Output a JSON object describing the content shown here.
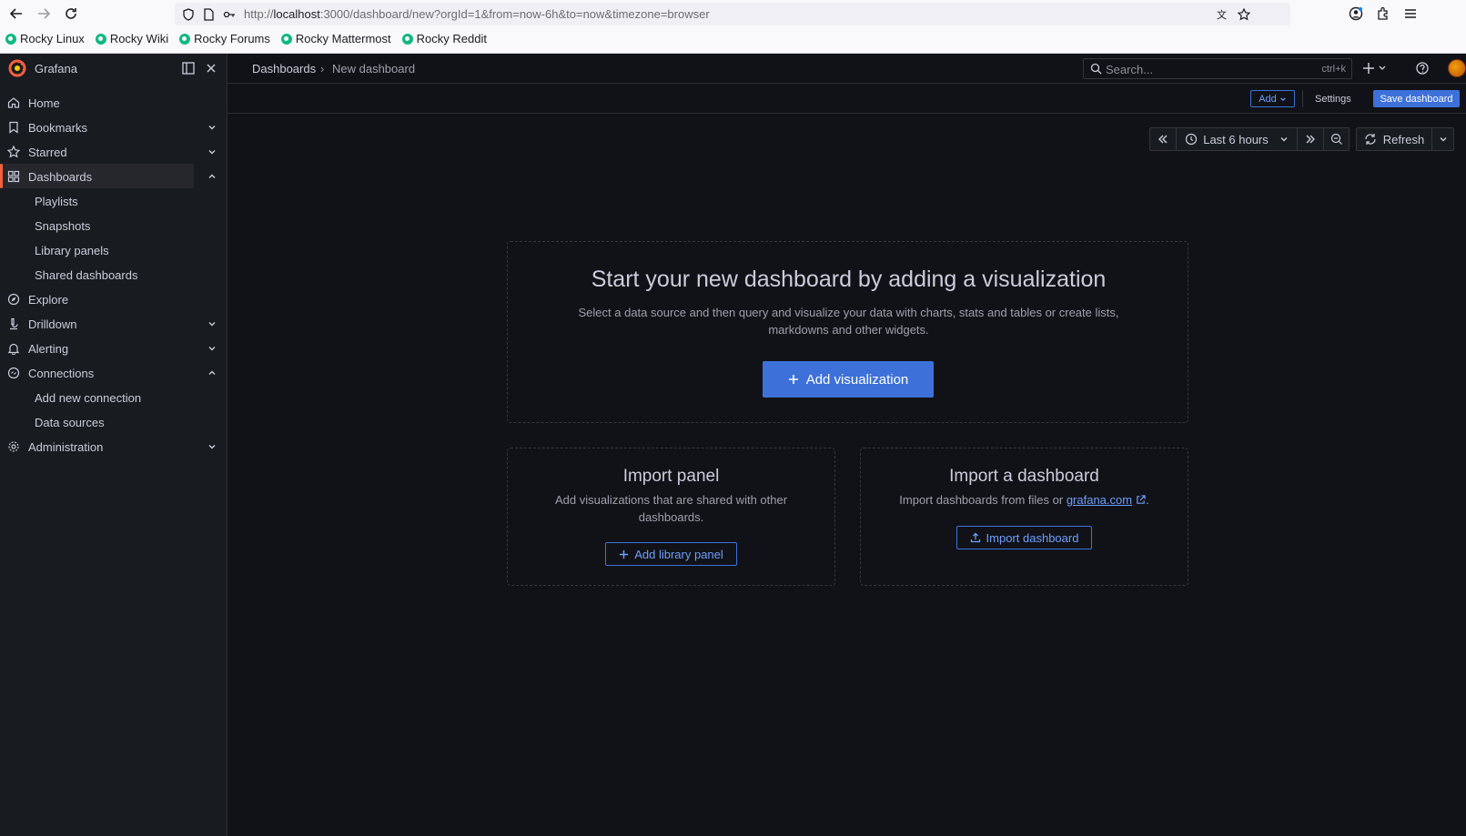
{
  "browser": {
    "url_prefix": "http://",
    "url_host": "localhost",
    "url_rest": ":3000/dashboard/new?orgId=1&from=now-6h&to=now&timezone=browser",
    "bookmarks": [
      "Rocky Linux",
      "Rocky Wiki",
      "Rocky Forums",
      "Rocky Mattermost",
      "Rocky Reddit"
    ]
  },
  "app": {
    "brand": "Grafana"
  },
  "sidebar": {
    "items": [
      {
        "label": "Home",
        "icon": "home-icon"
      },
      {
        "label": "Bookmarks",
        "icon": "bookmark-icon"
      },
      {
        "label": "Starred",
        "icon": "star-icon"
      },
      {
        "label": "Dashboards",
        "icon": "apps-icon"
      },
      {
        "label": "Playlists"
      },
      {
        "label": "Snapshots"
      },
      {
        "label": "Library panels"
      },
      {
        "label": "Shared dashboards"
      },
      {
        "label": "Explore",
        "icon": "compass-icon"
      },
      {
        "label": "Drilldown",
        "icon": "microscope-icon"
      },
      {
        "label": "Alerting",
        "icon": "bell-icon"
      },
      {
        "label": "Connections",
        "icon": "link-icon"
      },
      {
        "label": "Add new connection"
      },
      {
        "label": "Data sources"
      },
      {
        "label": "Administration",
        "icon": "cog-icon"
      }
    ]
  },
  "topbar": {
    "breadcrumb_root": "Dashboards",
    "breadcrumb_sep": "›",
    "breadcrumb_current": "New dashboard",
    "search_placeholder": "Search...",
    "search_shortcut": "ctrl+k"
  },
  "toolbar": {
    "add_label": "Add",
    "settings_label": "Settings",
    "save_label": "Save dashboard"
  },
  "timepicker": {
    "range_label": "Last 6 hours",
    "refresh_label": "Refresh"
  },
  "empty_state": {
    "title": "Start your new dashboard by adding a visualization",
    "description": "Select a data source and then query and visualize your data with charts, stats and tables or create lists, markdowns and other widgets.",
    "button_label": "Add visualization"
  },
  "import_panel": {
    "title": "Import panel",
    "description": "Add visualizations that are shared with other dashboards.",
    "button_label": "Add library panel"
  },
  "import_dashboard": {
    "title": "Import a dashboard",
    "description_prefix": "Import dashboards from files or ",
    "link_text": "grafana.com",
    "description_suffix": ".",
    "button_label": "Import dashboard"
  },
  "colors": {
    "accent": "#3d71d9",
    "brand_orange": "#f55f3e",
    "background": "#111217"
  }
}
